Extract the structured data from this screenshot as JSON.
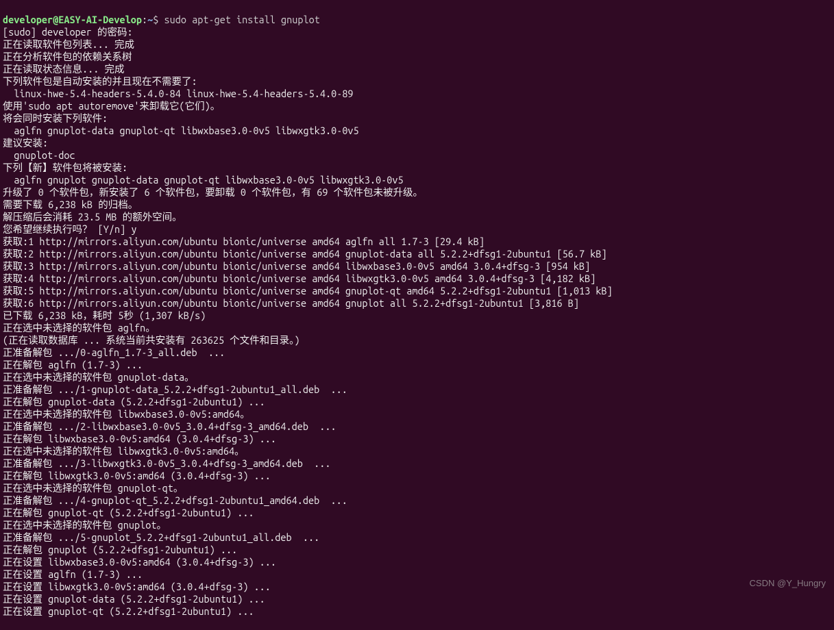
{
  "prompt": {
    "user_host": "developer@EASY-AI-Develop",
    "path": "~",
    "command": "sudo apt-get install gnuplot"
  },
  "lines": [
    "[sudo] developer 的密码:",
    "正在读取软件包列表... 完成",
    "正在分析软件包的依赖关系树",
    "正在读取状态信息... 完成",
    "下列软件包是自动安装的并且现在不需要了:",
    "  linux-hwe-5.4-headers-5.4.0-84 linux-hwe-5.4-headers-5.4.0-89",
    "使用'sudo apt autoremove'来卸载它(它们)。",
    "将会同时安装下列软件:",
    "  aglfn gnuplot-data gnuplot-qt libwxbase3.0-0v5 libwxgtk3.0-0v5",
    "建议安装:",
    "  gnuplot-doc",
    "下列【新】软件包将被安装:",
    "  aglfn gnuplot gnuplot-data gnuplot-qt libwxbase3.0-0v5 libwxgtk3.0-0v5",
    "升级了 0 个软件包，新安装了 6 个软件包，要卸载 0 个软件包，有 69 个软件包未被升级。",
    "需要下载 6,238 kB 的归档。",
    "解压缩后会消耗 23.5 MB 的额外空间。",
    "您希望继续执行吗？ [Y/n] y",
    "获取:1 http://mirrors.aliyun.com/ubuntu bionic/universe amd64 aglfn all 1.7-3 [29.4 kB]",
    "获取:2 http://mirrors.aliyun.com/ubuntu bionic/universe amd64 gnuplot-data all 5.2.2+dfsg1-2ubuntu1 [56.7 kB]",
    "获取:3 http://mirrors.aliyun.com/ubuntu bionic/universe amd64 libwxbase3.0-0v5 amd64 3.0.4+dfsg-3 [954 kB]",
    "获取:4 http://mirrors.aliyun.com/ubuntu bionic/universe amd64 libwxgtk3.0-0v5 amd64 3.0.4+dfsg-3 [4,182 kB]",
    "获取:5 http://mirrors.aliyun.com/ubuntu bionic/universe amd64 gnuplot-qt amd64 5.2.2+dfsg1-2ubuntu1 [1,013 kB]",
    "获取:6 http://mirrors.aliyun.com/ubuntu bionic/universe amd64 gnuplot all 5.2.2+dfsg1-2ubuntu1 [3,816 B]",
    "已下载 6,238 kB，耗时 5秒 (1,307 kB/s)",
    "正在选中未选择的软件包 aglfn。",
    "(正在读取数据库 ... 系统当前共安装有 263625 个文件和目录。)",
    "正准备解包 .../0-aglfn_1.7-3_all.deb  ...",
    "正在解包 aglfn (1.7-3) ...",
    "正在选中未选择的软件包 gnuplot-data。",
    "正准备解包 .../1-gnuplot-data_5.2.2+dfsg1-2ubuntu1_all.deb  ...",
    "正在解包 gnuplot-data (5.2.2+dfsg1-2ubuntu1) ...",
    "正在选中未选择的软件包 libwxbase3.0-0v5:amd64。",
    "正准备解包 .../2-libwxbase3.0-0v5_3.0.4+dfsg-3_amd64.deb  ...",
    "正在解包 libwxbase3.0-0v5:amd64 (3.0.4+dfsg-3) ...",
    "正在选中未选择的软件包 libwxgtk3.0-0v5:amd64。",
    "正准备解包 .../3-libwxgtk3.0-0v5_3.0.4+dfsg-3_amd64.deb  ...",
    "正在解包 libwxgtk3.0-0v5:amd64 (3.0.4+dfsg-3) ...",
    "正在选中未选择的软件包 gnuplot-qt。",
    "正准备解包 .../4-gnuplot-qt_5.2.2+dfsg1-2ubuntu1_amd64.deb  ...",
    "正在解包 gnuplot-qt (5.2.2+dfsg1-2ubuntu1) ...",
    "正在选中未选择的软件包 gnuplot。",
    "正准备解包 .../5-gnuplot_5.2.2+dfsg1-2ubuntu1_all.deb  ...",
    "正在解包 gnuplot (5.2.2+dfsg1-2ubuntu1) ...",
    "正在设置 libwxbase3.0-0v5:amd64 (3.0.4+dfsg-3) ...",
    "正在设置 aglfn (1.7-3) ...",
    "正在设置 libwxgtk3.0-0v5:amd64 (3.0.4+dfsg-3) ...",
    "正在设置 gnuplot-data (5.2.2+dfsg1-2ubuntu1) ...",
    "正在设置 gnuplot-qt (5.2.2+dfsg1-2ubuntu1) ..."
  ],
  "watermark": "CSDN @Y_Hungry"
}
